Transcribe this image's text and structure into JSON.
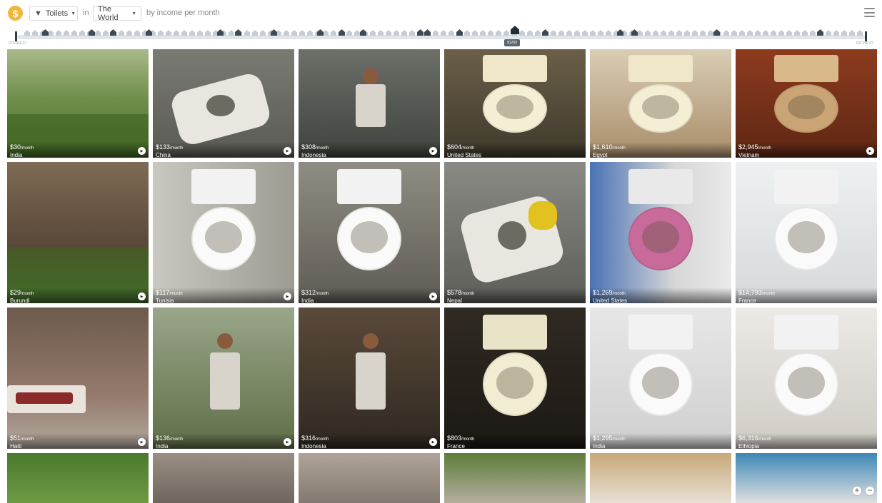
{
  "header": {
    "logo": "$",
    "thing": "Toilets",
    "in_word": "in",
    "place": "The World",
    "by_word": "by income per month"
  },
  "strip": {
    "left_label": "POOREST",
    "right_label": "RICHEST",
    "marker_label": "$1269"
  },
  "cards": [
    {
      "income": "$30",
      "unit": "/month",
      "country": "India",
      "play": true
    },
    {
      "income": "$133",
      "unit": "/month",
      "country": "China",
      "play": true
    },
    {
      "income": "$308",
      "unit": "/month",
      "country": "Indonesia",
      "play": true
    },
    {
      "income": "$604",
      "unit": "/month",
      "country": "United States",
      "play": false
    },
    {
      "income": "$1,610",
      "unit": "/month",
      "country": "Egypt",
      "play": false
    },
    {
      "income": "$2,945",
      "unit": "/month",
      "country": "Vietnam",
      "play": true
    },
    {
      "income": "$29",
      "unit": "/month",
      "country": "Burundi",
      "play": true
    },
    {
      "income": "$117",
      "unit": "/month",
      "country": "Tunisia",
      "play": true
    },
    {
      "income": "$312",
      "unit": "/month",
      "country": "India",
      "play": true
    },
    {
      "income": "$578",
      "unit": "/month",
      "country": "Nepal",
      "play": false
    },
    {
      "income": "$1,269",
      "unit": "/month",
      "country": "United States",
      "play": false
    },
    {
      "income": "$14,793",
      "unit": "/month",
      "country": "France",
      "play": false
    },
    {
      "income": "$51",
      "unit": "/month",
      "country": "Haiti",
      "play": true
    },
    {
      "income": "$136",
      "unit": "/month",
      "country": "India",
      "play": true
    },
    {
      "income": "$316",
      "unit": "/month",
      "country": "Indonesia",
      "play": true
    },
    {
      "income": "$803",
      "unit": "/month",
      "country": "France",
      "play": false
    },
    {
      "income": "$1,295",
      "unit": "/month",
      "country": "India",
      "play": false
    },
    {
      "income": "$6,316",
      "unit": "/month",
      "country": "Ethiopia",
      "play": false
    }
  ],
  "zoom": {
    "plus": "+",
    "minus": "−"
  },
  "colors": {
    "accent": "#f0b73c",
    "track": "#e2e6ea",
    "house": "#c5ccd4",
    "house_dark": "#3c4a57"
  }
}
